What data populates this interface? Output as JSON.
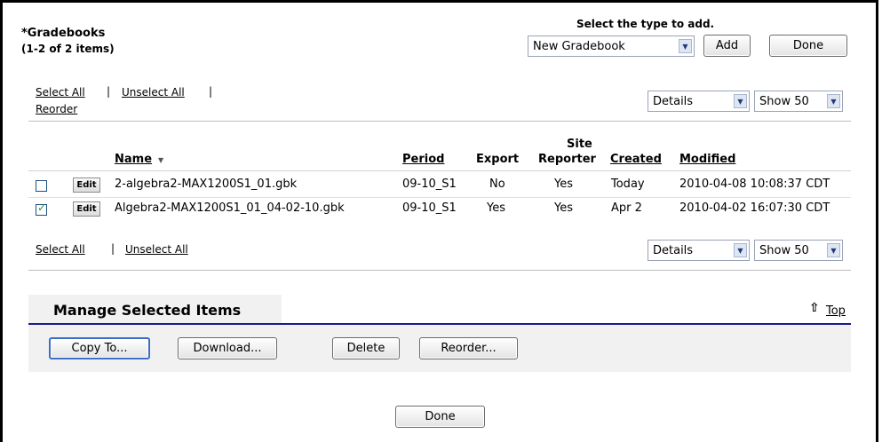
{
  "header": {
    "title": "*Gradebooks",
    "count": "(1-2 of 2 items)",
    "type_prompt": "Select the type to add.",
    "type_selected": "New Gradebook",
    "add_label": "Add",
    "done_label": "Done"
  },
  "top_links": {
    "select_all": "Select All",
    "unselect_all": "Unselect All",
    "separator": "|",
    "reorder": "Reorder"
  },
  "view_controls": {
    "view_selected": "Details",
    "show_selected": "Show 50"
  },
  "table": {
    "columns": {
      "name": "Name",
      "sort_glyph": "▼",
      "period": "Period",
      "export": "Export",
      "site_line1": "Site",
      "site_line2": "Reporter",
      "created": "Created",
      "modified": "Modified"
    },
    "edit_label": "Edit",
    "rows": [
      {
        "checked": false,
        "name": "2-algebra2-MAX1200S1_01.gbk",
        "period": "09-10_S1",
        "export": "No",
        "site_reporter": "Yes",
        "created": "Today",
        "modified": "2010-04-08 10:08:37 CDT"
      },
      {
        "checked": true,
        "name": "Algebra2-MAX1200S1_01_04-02-10.gbk",
        "period": "09-10_S1",
        "export": "Yes",
        "site_reporter": "Yes",
        "created": "Apr 2",
        "modified": "2010-04-02 16:07:30 CDT"
      }
    ]
  },
  "manage": {
    "title": "Manage Selected Items",
    "top_label": "Top",
    "copy_label": "Copy To...",
    "download_label": "Download...",
    "delete_label": "Delete",
    "reorder_label": "Reorder..."
  },
  "footer": {
    "done_label": "Done"
  },
  "colors": {
    "accent_line": "#1a1a8c",
    "panel_bg": "#f1f1f1",
    "check": "#21a121"
  }
}
